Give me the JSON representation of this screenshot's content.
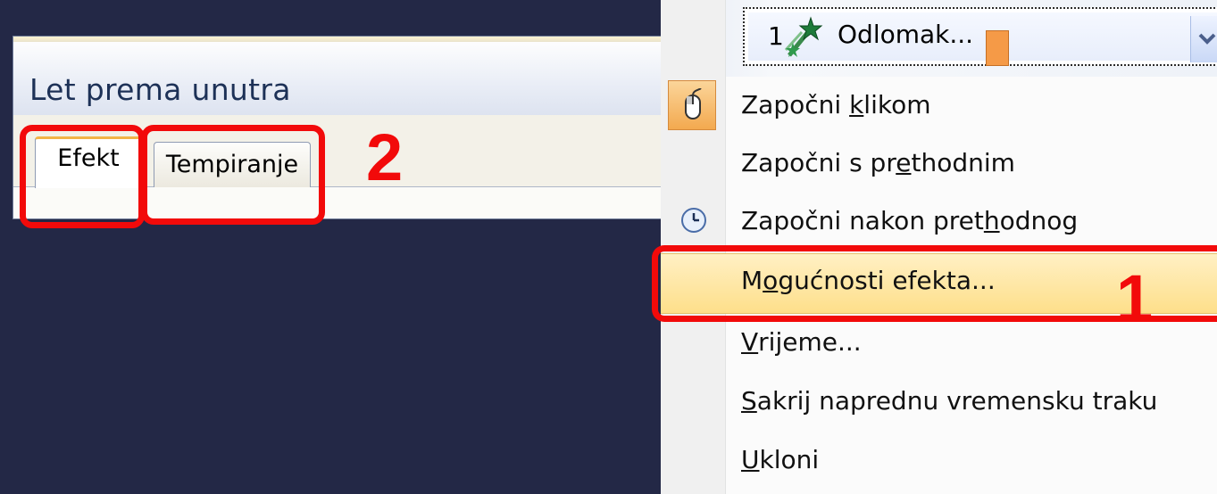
{
  "dialog": {
    "title": "Let prema unutra",
    "tabs": [
      {
        "label": "Efekt",
        "selected": true
      },
      {
        "label": "Tempiranje",
        "selected": false
      }
    ]
  },
  "annotations": {
    "tabs_step": "2",
    "menu_step": "1",
    "color": "#f20a0a"
  },
  "menu": {
    "combo": {
      "number": "1",
      "text": "Odlomak...",
      "icon": "effect-star-icon",
      "swatch_color": "#f59a47"
    },
    "items": [
      {
        "pre": "Započni ",
        "u": "k",
        "post": "likom",
        "icon": "mouse-click-icon"
      },
      {
        "pre": "Započni s pr",
        "u": "e",
        "post": "thodnim"
      },
      {
        "pre": "Započni nakon pret",
        "u": "h",
        "post": "odnog",
        "icon": "clock-icon"
      },
      {
        "pre": "M",
        "u": "o",
        "post": "gućnosti efekta...",
        "highlighted": true
      },
      {
        "pre": "",
        "u": "V",
        "post": "rijeme..."
      },
      {
        "pre": "",
        "u": "S",
        "post": "akrij naprednu vremensku traku"
      },
      {
        "pre": "",
        "u": "U",
        "post": "kloni"
      }
    ]
  }
}
